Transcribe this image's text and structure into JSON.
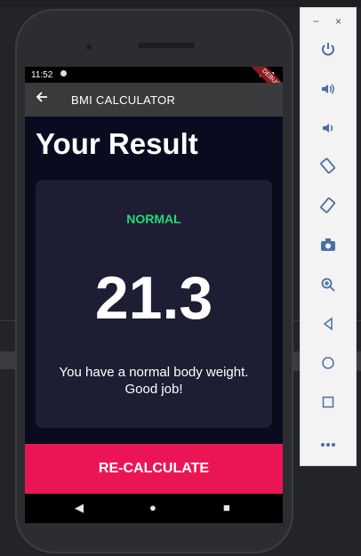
{
  "status_bar": {
    "time": "11:52",
    "right_icons": "▾◢▮",
    "debug_ribbon": "DEBUG"
  },
  "app_bar": {
    "back_icon": "arrow-back-icon",
    "title": "BMI CALCULATOR"
  },
  "result": {
    "heading": "Your Result",
    "status": "NORMAL",
    "bmi": "21.3",
    "interpretation": "You have a normal body weight. Good job!"
  },
  "button": {
    "label": "RE-CALCULATE"
  },
  "nav": {
    "back": "◀",
    "home": "●",
    "overview": "■"
  },
  "emulator": {
    "minimize": "−",
    "close": "×",
    "tools": [
      {
        "icon": "power-icon",
        "glyph": "⏻"
      },
      {
        "icon": "volume-up-icon",
        "glyph": "🔊"
      },
      {
        "icon": "volume-down-icon",
        "glyph": "🔉"
      },
      {
        "icon": "rotate-left-icon",
        "glyph": "⟲"
      },
      {
        "icon": "rotate-right-icon",
        "glyph": "⟳"
      },
      {
        "icon": "camera-icon",
        "glyph": "📷"
      },
      {
        "icon": "zoom-icon",
        "glyph": "⊕"
      },
      {
        "icon": "back-icon",
        "glyph": "◁"
      },
      {
        "icon": "home-icon",
        "glyph": "○"
      },
      {
        "icon": "overview-icon",
        "glyph": "□"
      },
      {
        "icon": "more-icon",
        "glyph": "⋯"
      }
    ]
  },
  "colors": {
    "accent": "#eb1555",
    "normal": "#24d876",
    "card": "#1d1e33",
    "background": "#090c1f"
  }
}
